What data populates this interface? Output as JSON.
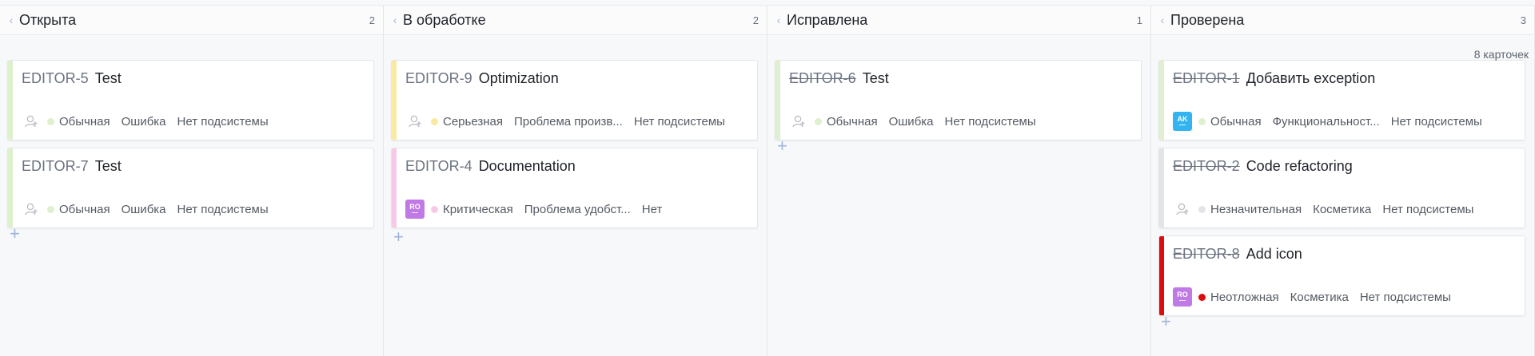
{
  "board": {
    "cards_count_label": "8 карточек",
    "columns": [
      {
        "title": "Открыта",
        "count": "2",
        "cards": [
          {
            "id": "EDITOR-5",
            "summary": "Test",
            "resolved": false,
            "stripe": "#dff0cf",
            "assignee": null,
            "priority": "Обычная",
            "priority_color": "#dff0cf",
            "type": "Ошибка",
            "subsystem": "Нет подсистемы"
          },
          {
            "id": "EDITOR-7",
            "summary": "Test",
            "resolved": false,
            "stripe": "#dff0cf",
            "assignee": null,
            "priority": "Обычная",
            "priority_color": "#dff0cf",
            "type": "Ошибка",
            "subsystem": "Нет подсистемы"
          }
        ]
      },
      {
        "title": "В обработке",
        "count": "2",
        "cards": [
          {
            "id": "EDITOR-9",
            "summary": "Optimization",
            "resolved": false,
            "stripe": "#fae9a0",
            "assignee": null,
            "priority": "Серьезная",
            "priority_color": "#fae9a0",
            "type": "Проблема произв...",
            "subsystem": "Нет подсистемы"
          },
          {
            "id": "EDITOR-4",
            "summary": "Documentation",
            "resolved": false,
            "stripe": "#f8c9e6",
            "assignee": {
              "initials": "RO",
              "color": "#c07ae6"
            },
            "priority": "Критическая",
            "priority_color": "#f8c9e6",
            "type": "Проблема удобст...",
            "subsystem": "Нет"
          }
        ]
      },
      {
        "title": "Исправлена",
        "count": "1",
        "cards": [
          {
            "id": "EDITOR-6",
            "summary": "Test",
            "resolved": true,
            "stripe": "#dff0cf",
            "assignee": null,
            "priority": "Обычная",
            "priority_color": "#dff0cf",
            "type": "Ошибка",
            "subsystem": "Нет подсистемы"
          }
        ]
      },
      {
        "title": "Проверена",
        "count": "3",
        "cards": [
          {
            "id": "EDITOR-1",
            "summary": "Добавить exception",
            "resolved": true,
            "stripe": "#dff0cf",
            "assignee": {
              "initials": "AK",
              "color": "#33b4f0"
            },
            "priority": "Обычная",
            "priority_color": "#dff0cf",
            "type": "Функциональност...",
            "subsystem": "Нет подсистемы"
          },
          {
            "id": "EDITOR-2",
            "summary": "Code refactoring",
            "resolved": true,
            "stripe": "#e3e4e6",
            "assignee": null,
            "priority": "Незначительная",
            "priority_color": "#e3e4e6",
            "type": "Косметика",
            "subsystem": "Нет подсистемы"
          },
          {
            "id": "EDITOR-8",
            "summary": "Add icon",
            "resolved": true,
            "stripe": "#dd0b0b",
            "assignee": {
              "initials": "RO",
              "color": "#c07ae6"
            },
            "priority": "Неотложная",
            "priority_color": "#dd0b0b",
            "type": "Косметика",
            "subsystem": "Нет подсистемы"
          }
        ]
      }
    ]
  }
}
